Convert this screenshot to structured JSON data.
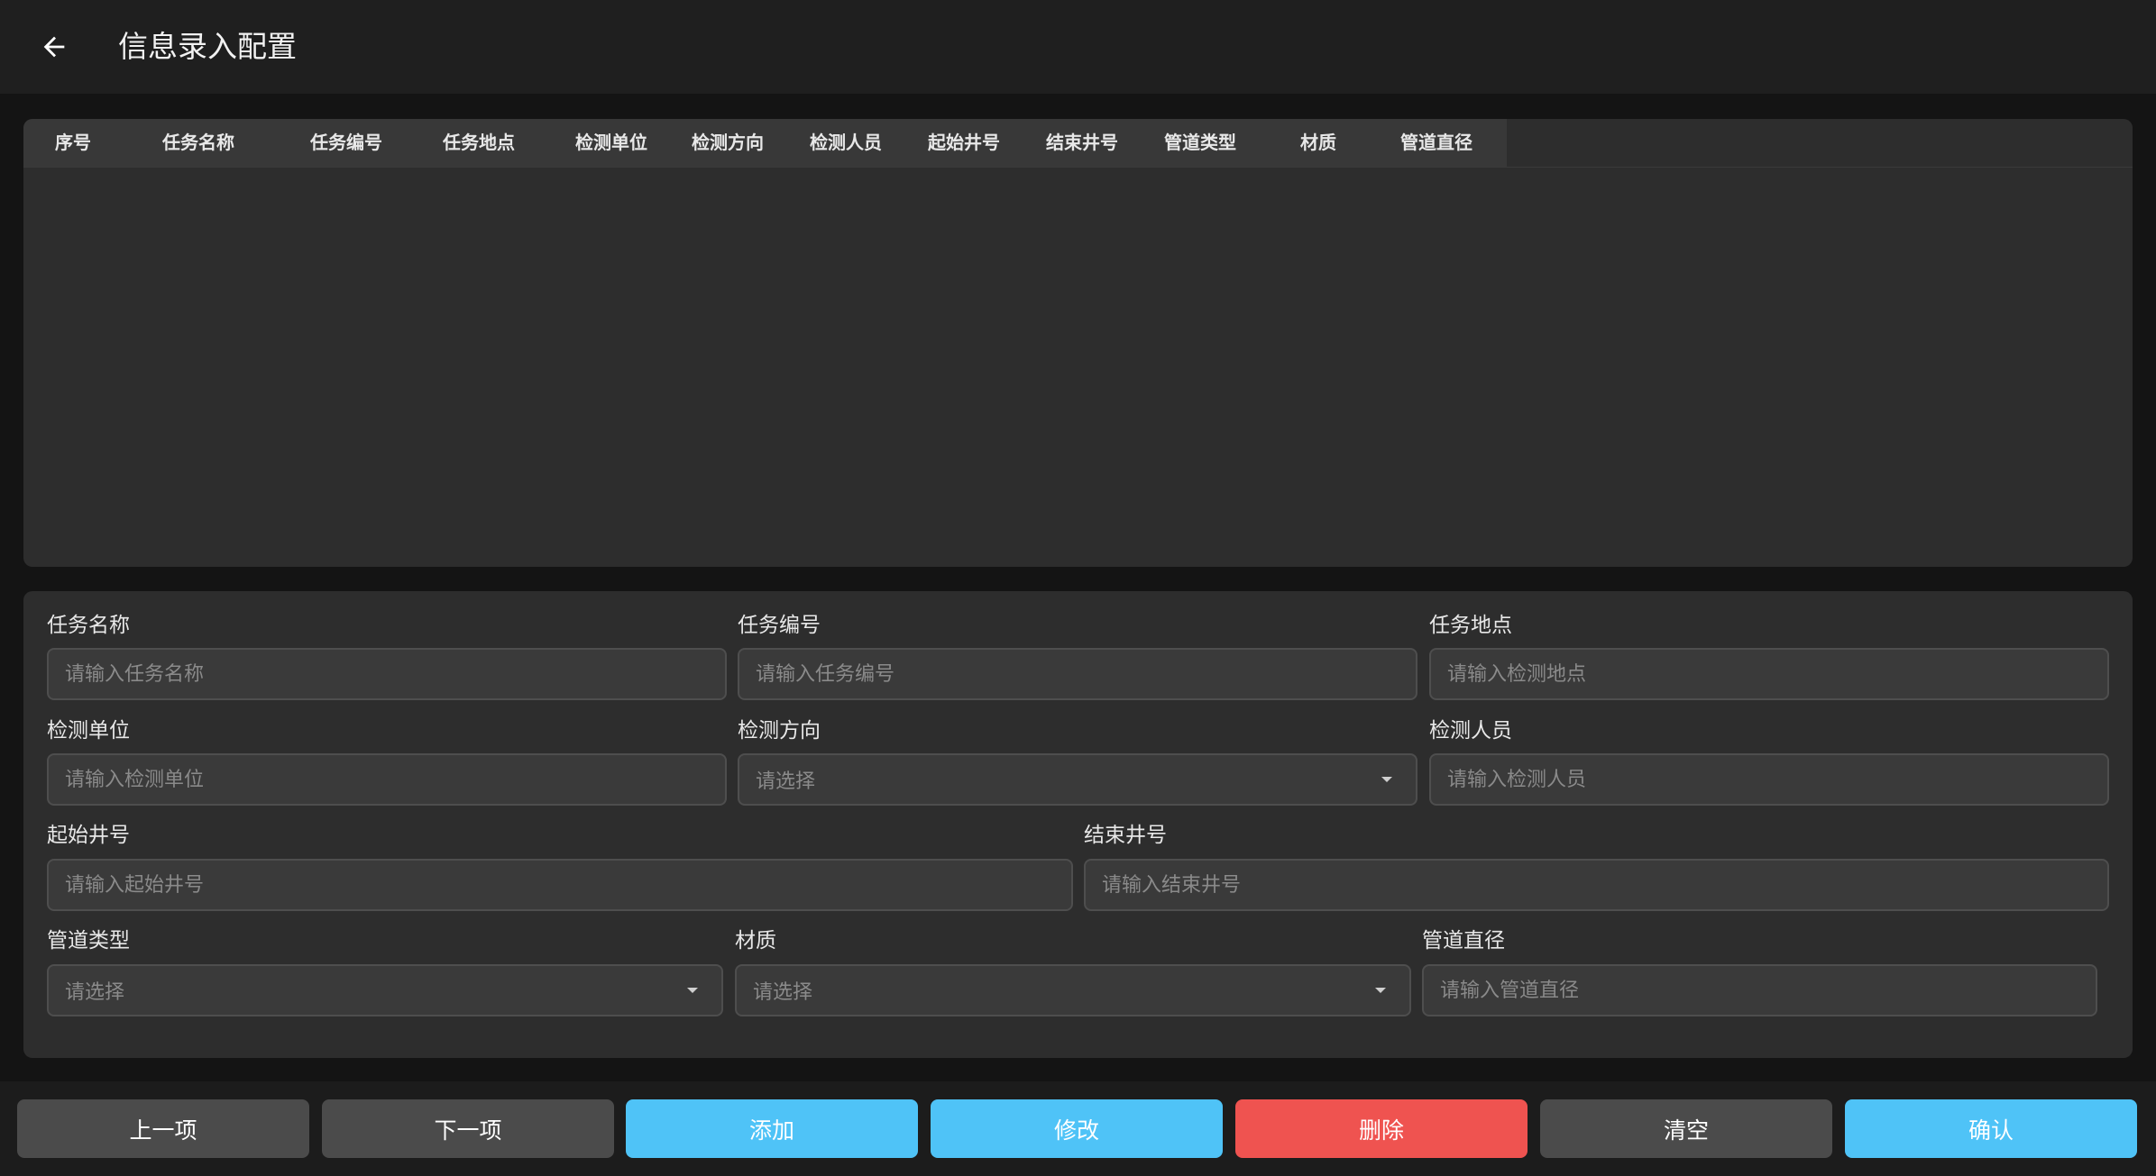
{
  "header": {
    "title": "信息录入配置"
  },
  "table": {
    "columns": [
      "序号",
      "任务名称",
      "任务编号",
      "任务地点",
      "检测单位",
      "检测方向",
      "检测人员",
      "起始井号",
      "结束井号",
      "管道类型",
      "材质",
      "管道直径"
    ]
  },
  "form": {
    "task_name": {
      "label": "任务名称",
      "placeholder": "请输入任务名称"
    },
    "task_code": {
      "label": "任务编号",
      "placeholder": "请输入任务编号"
    },
    "task_location": {
      "label": "任务地点",
      "placeholder": "请输入检测地点"
    },
    "inspect_unit": {
      "label": "检测单位",
      "placeholder": "请输入检测单位"
    },
    "inspect_direction": {
      "label": "检测方向",
      "placeholder": "请选择"
    },
    "inspector": {
      "label": "检测人员",
      "placeholder": "请输入检测人员"
    },
    "start_well": {
      "label": "起始井号",
      "placeholder": "请输入起始井号"
    },
    "end_well": {
      "label": "结束井号",
      "placeholder": "请输入结束井号"
    },
    "pipe_type": {
      "label": "管道类型",
      "placeholder": "请选择"
    },
    "material": {
      "label": "材质",
      "placeholder": "请选择"
    },
    "pipe_diameter": {
      "label": "管道直径",
      "placeholder": "请输入管道直径"
    }
  },
  "footer": {
    "prev_label": "上一项",
    "next_label": "下一项",
    "add_label": "添加",
    "edit_label": "修改",
    "delete_label": "删除",
    "clear_label": "清空",
    "confirm_label": "确认"
  },
  "colors": {
    "accent": "#4fc3f7",
    "danger": "#ef5350",
    "neutral_button": "#4b4b4b"
  }
}
